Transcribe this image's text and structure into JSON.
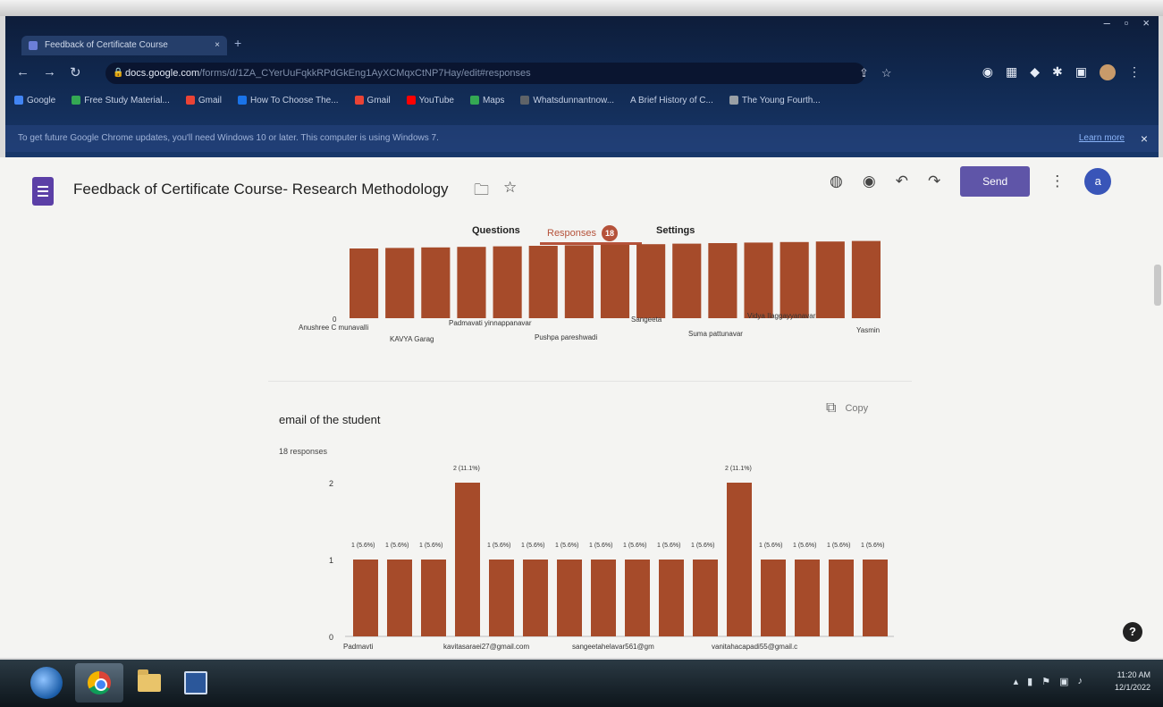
{
  "browser": {
    "tab_title": "Feedback of Certificate Course",
    "tab_close": "×",
    "new_tab": "+",
    "window_controls": [
      "–",
      "▫",
      "×"
    ],
    "url_domain": "docs.google.com",
    "url_path": "/forms/d/1ZA_CYerUuFqkkRPdGkEng1AyXCMqxCtNP7Hay/edit#responses",
    "bookmarks": [
      {
        "label": "Google",
        "color": "#4285f4"
      },
      {
        "label": "Free Study Material...",
        "color": "#34a853"
      },
      {
        "label": "Gmail",
        "color": "#ea4335"
      },
      {
        "label": "How To Choose The...",
        "color": "#1a73e8"
      },
      {
        "label": "Gmail",
        "color": "#ea4335"
      },
      {
        "label": "YouTube",
        "color": "#ff0000"
      },
      {
        "label": "Maps",
        "color": "#34a853"
      },
      {
        "label": "Whatsdunnantnow...",
        "color": "#5f6368"
      },
      {
        "label": "A Brief History of C...",
        "color": "#9aa0a6"
      },
      {
        "label": "The Young Fourth...",
        "color": "#9aa0a6"
      }
    ],
    "infobar_text": "To get future Google Chrome updates, you'll need Windows 10 or later. This computer is using Windows 7.",
    "infobar_link": "Learn more",
    "infobar_close": "×"
  },
  "form": {
    "title": "Feedback of Certificate Course- Research Methodology",
    "send_label": "Send",
    "avatar_letter": "a",
    "tabs": {
      "questions": "Questions",
      "responses": "Responses",
      "responses_count": "18",
      "settings": "Settings"
    }
  },
  "name_chart": {
    "chart_data": {
      "type": "bar",
      "y_tick": "0",
      "categories": [
        "Anushree C munavalli",
        "KAVYA Garag",
        "Padmavati yinnappanavar",
        "Pushpa pareshwadi",
        "Sangeeta",
        "Suma pattunavar",
        "Vidya Ilaggayyanavar",
        "Yasmin"
      ],
      "bar_count": 15,
      "bar_color": "#a64b2a"
    }
  },
  "email_question": {
    "title": "email of the student",
    "responses_label": "18 responses",
    "copy_label": "Copy",
    "chart_data": {
      "type": "bar",
      "y_ticks": [
        "0",
        "1",
        "2"
      ],
      "ylim": [
        0,
        2
      ],
      "values": [
        1,
        1,
        1,
        2,
        1,
        1,
        1,
        1,
        1,
        1,
        1,
        2,
        1,
        1,
        1,
        1
      ],
      "data_labels": [
        "1 (5.6%)",
        "1 (5.6%)",
        "1 (5.6%)",
        "2 (11.1%)",
        "1 (5.6%)",
        "1 (5.6%)",
        "1 (5.6%)",
        "1 (5.6%)",
        "1 (5.6%)",
        "1 (5.6%)",
        "1 (5.6%)",
        "2 (11.1%)",
        "1 (5.6%)",
        "1 (5.6%)",
        "1 (5.6%)",
        "1 (5.6%)"
      ],
      "x_labels": [
        "Padmavti",
        "kavitasaraei27@gmail.com",
        "sangeetahelavar561@gm",
        "vanitahacapadi55@gmail.c"
      ],
      "bar_color": "#a64b2a"
    }
  },
  "help_label": "?",
  "taskbar": {
    "clock_time": "11:20 AM",
    "clock_date": "12/1/2022"
  }
}
